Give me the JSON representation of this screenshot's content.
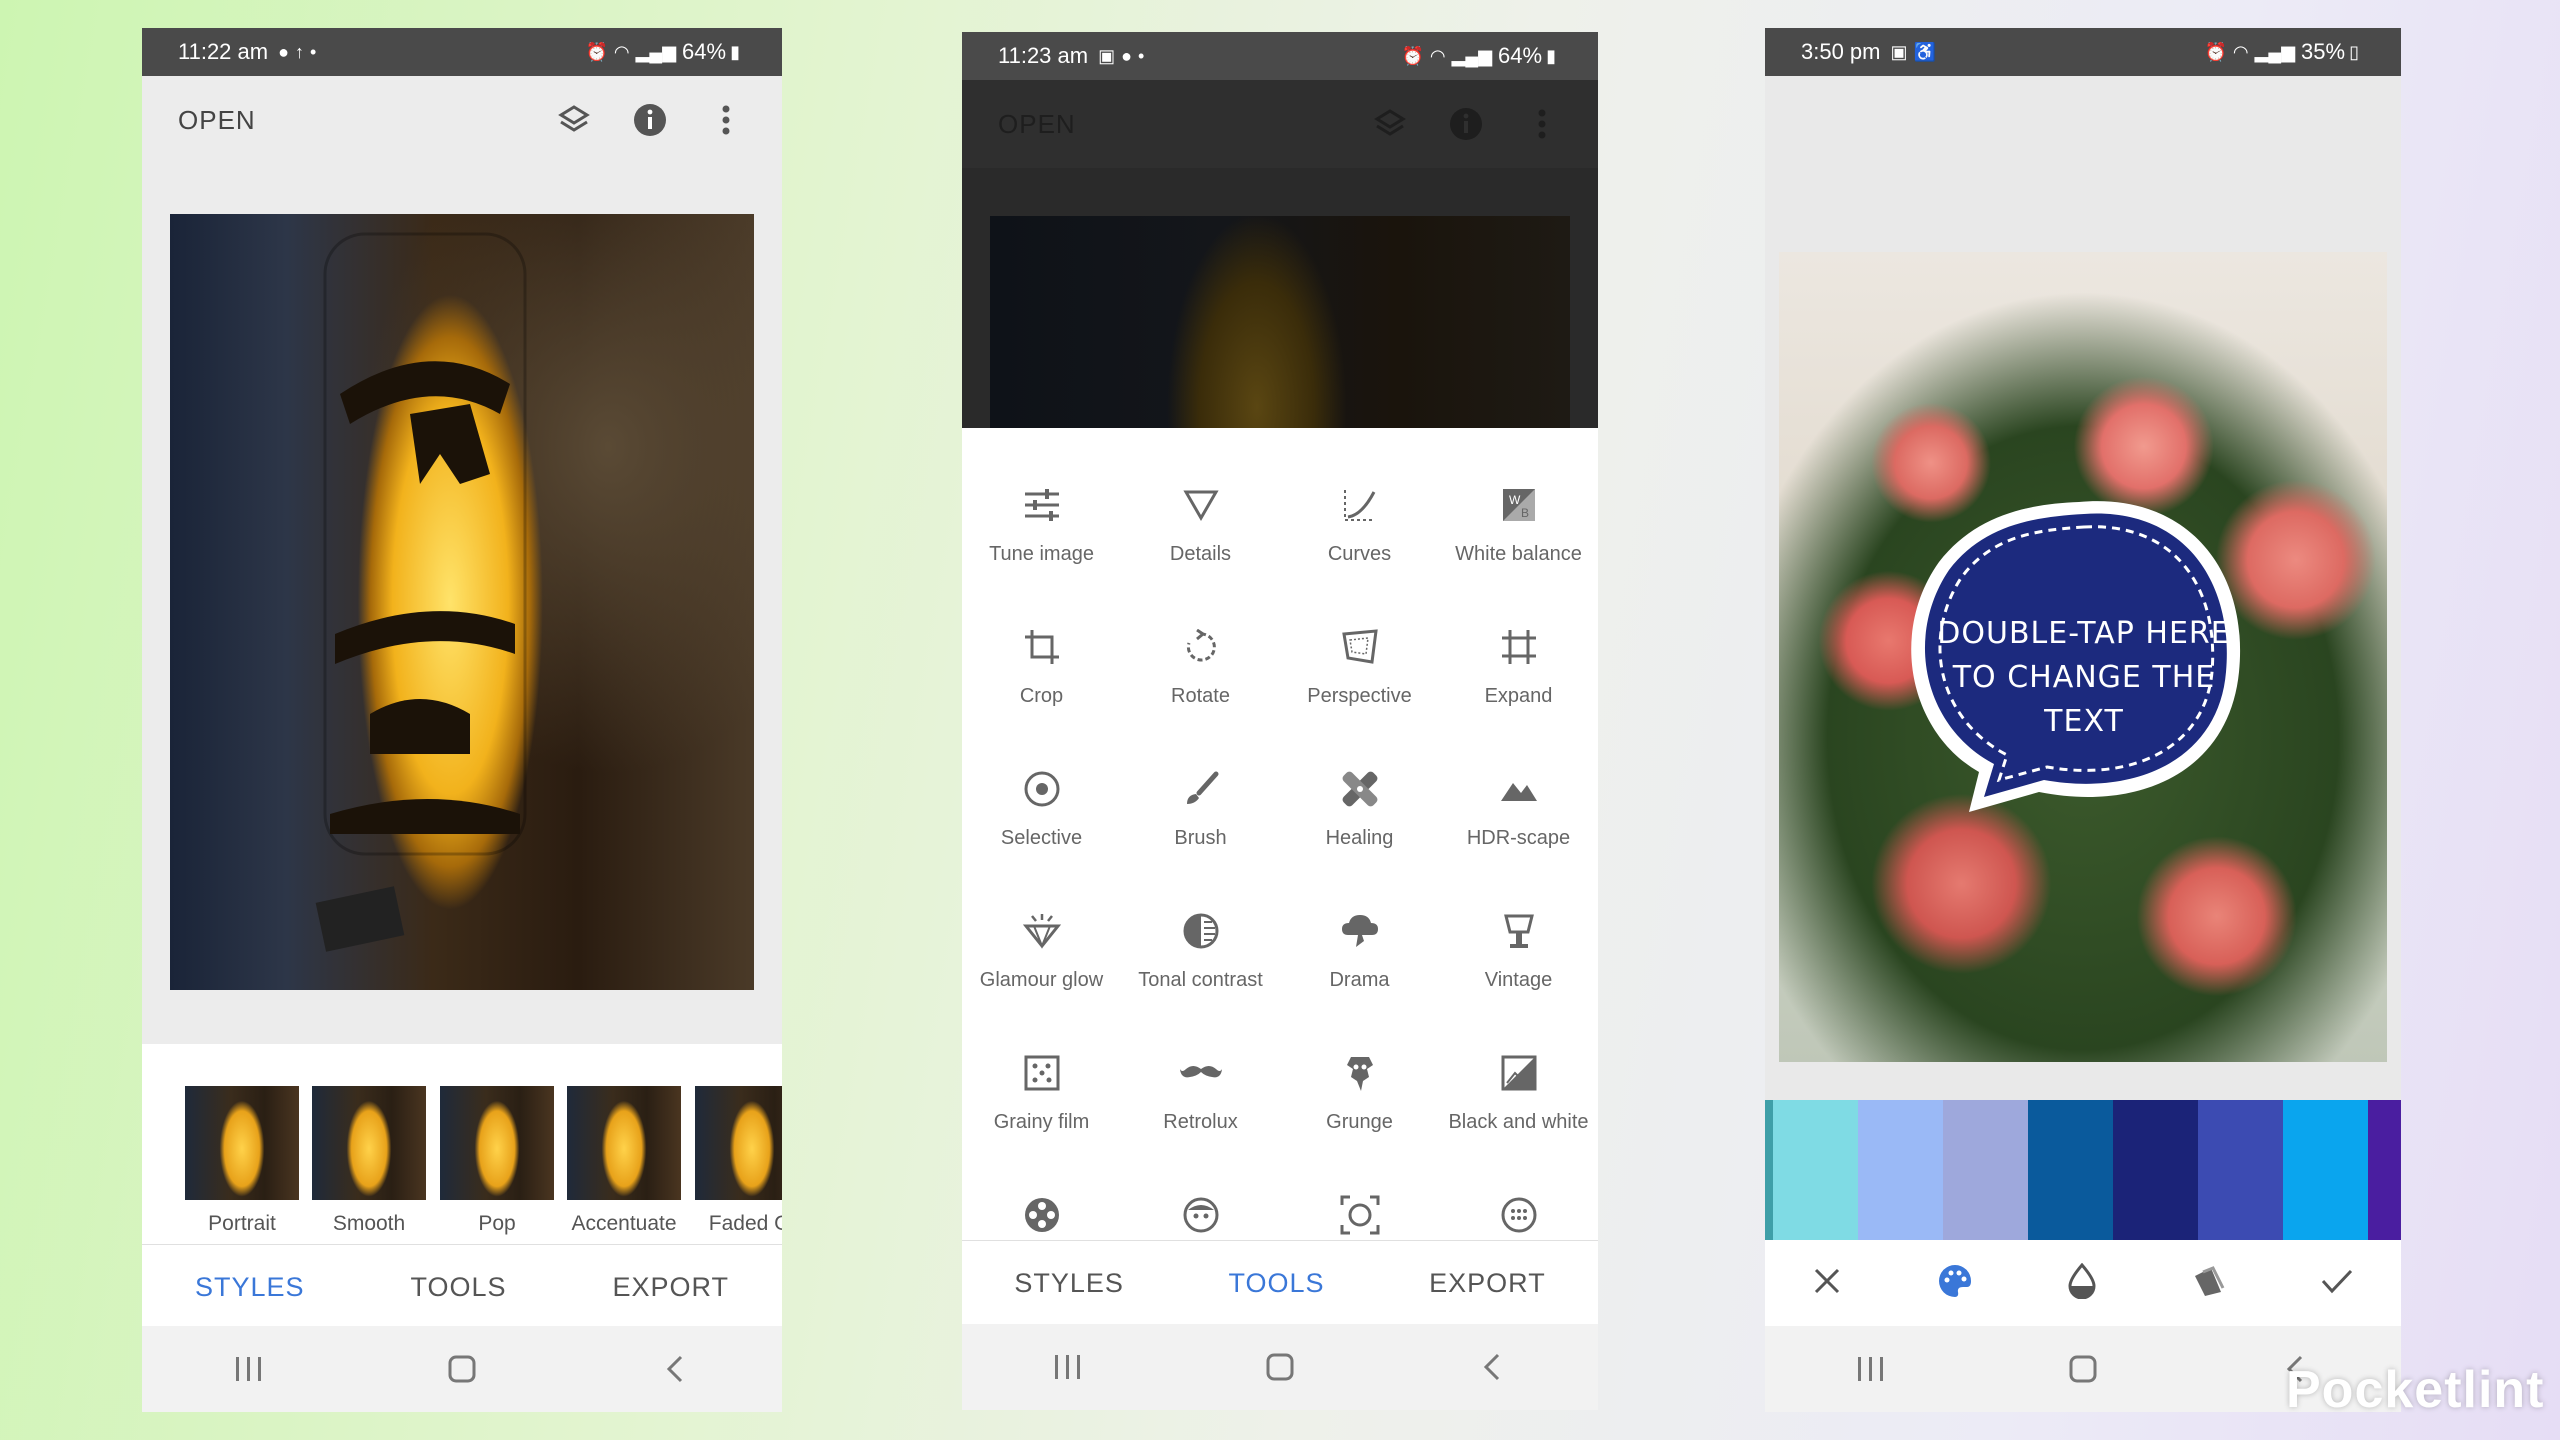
{
  "phone1": {
    "status": {
      "time": "11:22 am",
      "battery": "64%"
    },
    "toolbar": {
      "open_label": "OPEN"
    },
    "styles": [
      {
        "label": "Portrait"
      },
      {
        "label": "Smooth"
      },
      {
        "label": "Pop"
      },
      {
        "label": "Accentuate"
      },
      {
        "label": "Faded Gl"
      }
    ],
    "tabs": {
      "styles": "STYLES",
      "tools": "TOOLS",
      "export": "EXPORT",
      "active": "styles"
    }
  },
  "phone2": {
    "status": {
      "time": "11:23 am",
      "battery": "64%"
    },
    "toolbar": {
      "open_label": "OPEN"
    },
    "tools": [
      {
        "label": "Tune image",
        "icon": "tune-icon"
      },
      {
        "label": "Details",
        "icon": "details-icon"
      },
      {
        "label": "Curves",
        "icon": "curves-icon"
      },
      {
        "label": "White balance",
        "icon": "white-balance-icon"
      },
      {
        "label": "Crop",
        "icon": "crop-icon"
      },
      {
        "label": "Rotate",
        "icon": "rotate-icon"
      },
      {
        "label": "Perspective",
        "icon": "perspective-icon"
      },
      {
        "label": "Expand",
        "icon": "expand-icon"
      },
      {
        "label": "Selective",
        "icon": "selective-icon"
      },
      {
        "label": "Brush",
        "icon": "brush-icon"
      },
      {
        "label": "Healing",
        "icon": "healing-icon"
      },
      {
        "label": "HDR-scape",
        "icon": "hdr-icon"
      },
      {
        "label": "Glamour glow",
        "icon": "glamour-glow-icon"
      },
      {
        "label": "Tonal contrast",
        "icon": "tonal-contrast-icon"
      },
      {
        "label": "Drama",
        "icon": "drama-icon"
      },
      {
        "label": "Vintage",
        "icon": "vintage-icon"
      },
      {
        "label": "Grainy film",
        "icon": "grainy-film-icon"
      },
      {
        "label": "Retrolux",
        "icon": "retrolux-icon"
      },
      {
        "label": "Grunge",
        "icon": "grunge-icon"
      },
      {
        "label": "Black and white",
        "icon": "black-white-icon"
      }
    ],
    "tabs": {
      "styles": "STYLES",
      "tools": "TOOLS",
      "export": "EXPORT",
      "active": "tools"
    }
  },
  "phone3": {
    "status": {
      "time": "3:50 pm",
      "battery": "35%"
    },
    "bubble_text_line1": "DOUBLE-TAP HERE",
    "bubble_text_line2": "TO CHANGE THE TEXT",
    "swatches": [
      "#3f9fa8",
      "#7fdbe4",
      "#9ab9f6",
      "#9ea8dc",
      "#0a5a9c",
      "#1b2378",
      "#3c4bb2",
      "#0aa5ee",
      "#4a1ea0"
    ],
    "actions": [
      "close-icon",
      "palette-icon",
      "opacity-icon",
      "style-icon",
      "check-icon"
    ]
  },
  "watermark": "Pocketlint"
}
